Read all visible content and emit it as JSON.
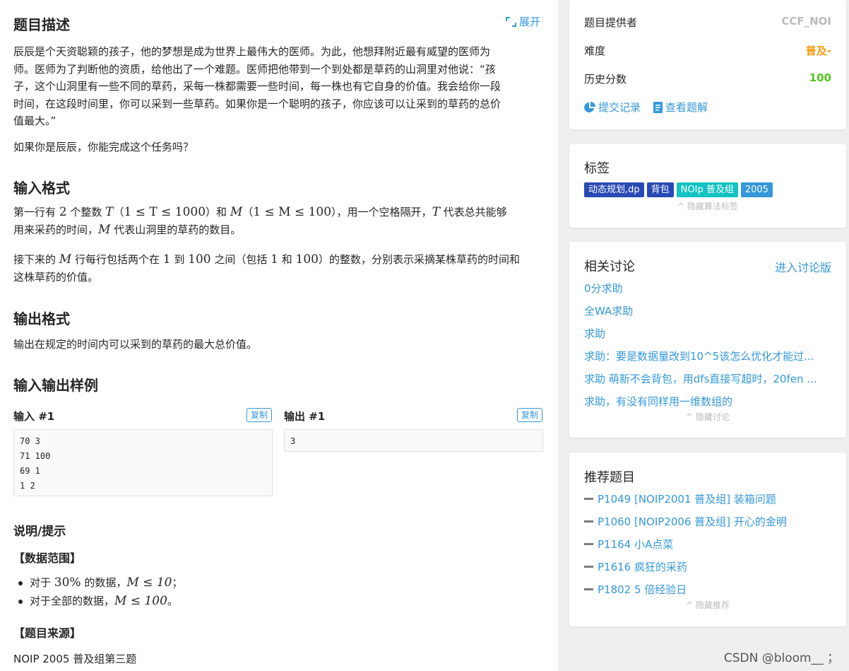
{
  "problem": {
    "description_title": "题目描述",
    "expand_label": "展开",
    "description_p1_lines": [
      "辰辰是个天资聪颖的孩子，他的梦想是成为世界上最伟大的医师。为此，他想拜附近最有威望的医师为",
      "师。医师为了判断他的资质，给他出了一个难题。医师把他带到一个到处都是草药的山洞里对他说：“孩",
      "子，这个山洞里有一些不同的草药，采每一株都需要一些时间，每一株也有它自身的价值。我会给你一段",
      "时间，在这段时间里，你可以采到一些草药。如果你是一个聪明的孩子，你应该可以让采到的草药的总价",
      "值最大。”"
    ],
    "description_p2": "如果你是辰辰，你能完成这个任务吗？",
    "input_title": "输入格式",
    "input_p1": {
      "a": "第一行有 ",
      "n2": "2",
      "b": " 个整数 ",
      "T": "T",
      "c1": "（",
      "cond1": "1 ≤ T ≤ 1000",
      "c2": "）和 ",
      "M": "M",
      "c3": "（",
      "cond2": "1 ≤ M ≤ 100",
      "c4": "），用一个空格隔开，",
      "T2": "T",
      "d": " 代表总共能够",
      "line2a": "用来采药的时间，",
      "M2": "M",
      "line2b": " 代表山洞里的草药的数目。"
    },
    "input_p2": {
      "a": "接下来的 ",
      "M": "M",
      "b": " 行每行包括两个在 ",
      "n1": "1",
      "c": " 到 ",
      "n100": "100",
      "d": " 之间（包括 ",
      "n1b": "1",
      "e": " 和 ",
      "n100b": "100",
      "f": "）的整数，分别表示采摘某株草药的时间和",
      "line2": "这株草药的价值。"
    },
    "output_title": "输出格式",
    "output_p": "输出在规定的时间内可以采到的草药的最大总价值。",
    "samples_title": "输入输出样例",
    "input_label": "输入 #1",
    "output_label": "输出 #1",
    "copy_label": "复制",
    "sample_input": [
      "70 3",
      "71 100",
      "69 1",
      "1 2"
    ],
    "sample_output": [
      "3"
    ],
    "hint_title": "说明/提示",
    "range_title": "【数据范围】",
    "bullet1": {
      "a": "对于 ",
      "pct": "30%",
      "b": " 的数据，",
      "cond": "M ≤ 10",
      "c": "；"
    },
    "bullet2": {
      "a": "对于全部的数据，",
      "cond": "M ≤ 100",
      "c": "。"
    },
    "source_title": "【题目来源】",
    "source": "NOIP 2005 普及组第三题"
  },
  "info": {
    "provider_label": "题目提供者",
    "provider": "CCF_NOI",
    "difficulty_label": "难度",
    "difficulty": "普及-",
    "difficulty_color": "#f39c11",
    "score_label": "历史分数",
    "score": "100",
    "score_color": "#52c41a",
    "submissions": "提交记录",
    "solutions": "查看题解"
  },
  "tags": {
    "title": "标签",
    "items": [
      {
        "label": "动态规划,dp",
        "color": "#2949b4"
      },
      {
        "label": "背包",
        "color": "#2949b4"
      },
      {
        "label": "NOIp 普及组",
        "color": "#13c2c2"
      },
      {
        "label": "2005",
        "color": "#3498db"
      }
    ],
    "hide": "隐藏算法标签"
  },
  "discussion": {
    "title": "相关讨论",
    "enter": "进入讨论版",
    "items": [
      "0分求助",
      "全WA求助",
      "求助",
      "求助：要是数据量改到10^5该怎么优化才能过...",
      "求助 萌新不会背包，用dfs直接写超时，20fen ...",
      "求助，有没有同样用一维数组的"
    ],
    "hide": "隐藏讨论"
  },
  "recommend": {
    "title": "推荐题目",
    "items": [
      "P1049 [NOIP2001 普及组] 装箱问题",
      "P1060 [NOIP2006 普及组] 开心的金明",
      "P1164 小A点菜",
      "P1616 疯狂的采药",
      "P1802 5 倍经验日"
    ],
    "hide": "隐藏推荐"
  },
  "watermark": "CSDN @bloom__ ；"
}
